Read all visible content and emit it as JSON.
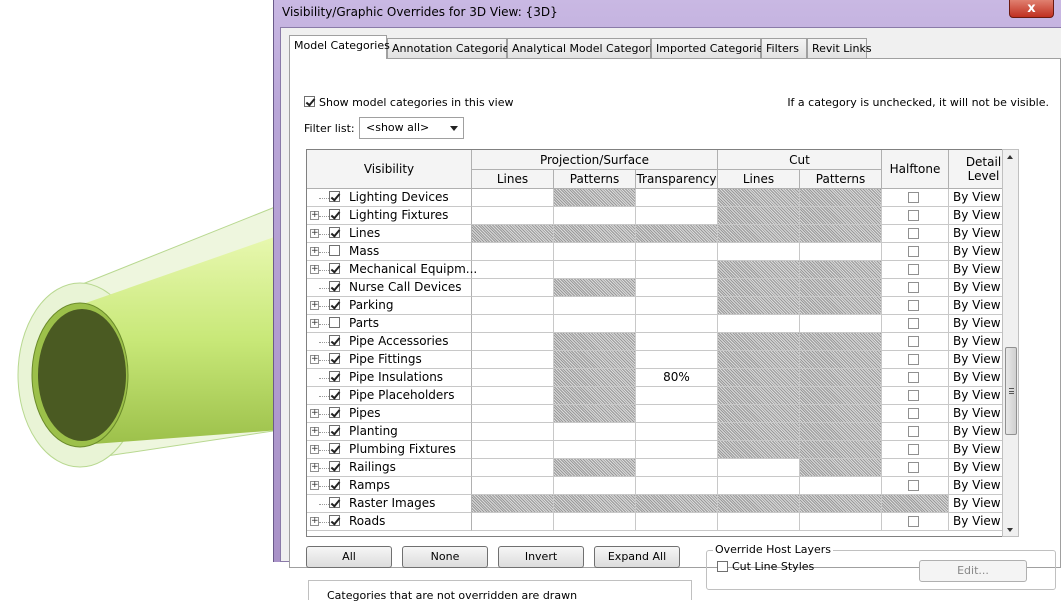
{
  "dialog": {
    "title": "Visibility/Graphic Overrides for 3D View: {3D}",
    "close_glyph": "x"
  },
  "tabs": [
    {
      "label": "Model Categories",
      "active": true
    },
    {
      "label": "Annotation Categories"
    },
    {
      "label": "Analytical Model Categories"
    },
    {
      "label": "Imported Categories"
    },
    {
      "label": "Filters"
    },
    {
      "label": "Revit Links"
    }
  ],
  "show_categories": {
    "label": "Show model categories in this view",
    "checked": true
  },
  "hint_text": "If a category is unchecked, it will not be visible.",
  "filter": {
    "label": "Filter list:",
    "value": "<show all>"
  },
  "table": {
    "headers": {
      "visibility": "Visibility",
      "projection_surface": "Projection/Surface",
      "cut": "Cut",
      "halftone": "Halftone",
      "detail_level": "Detail Level",
      "lines": "Lines",
      "patterns": "Patterns",
      "transparency": "Transparency",
      "cut_lines": "Lines",
      "cut_patterns": "Patterns"
    },
    "rows": [
      {
        "name": "Lighting Devices",
        "expander": false,
        "checked": true,
        "transparency": "",
        "detail": "By View"
      },
      {
        "name": "Lighting Fixtures",
        "expander": true,
        "checked": true,
        "transparency": "",
        "detail": "By View"
      },
      {
        "name": "Lines",
        "expander": true,
        "checked": true,
        "transparency": "",
        "detail": "By View"
      },
      {
        "name": "Mass",
        "expander": true,
        "checked": false,
        "transparency": "",
        "detail": "By View"
      },
      {
        "name": "Mechanical Equipm...",
        "expander": true,
        "checked": true,
        "transparency": "",
        "detail": "By View"
      },
      {
        "name": "Nurse Call Devices",
        "expander": false,
        "checked": true,
        "transparency": "",
        "detail": "By View"
      },
      {
        "name": "Parking",
        "expander": true,
        "checked": true,
        "transparency": "",
        "detail": "By View"
      },
      {
        "name": "Parts",
        "expander": true,
        "checked": false,
        "transparency": "",
        "detail": "By View"
      },
      {
        "name": "Pipe Accessories",
        "expander": false,
        "checked": true,
        "transparency": "",
        "detail": "By View"
      },
      {
        "name": "Pipe Fittings",
        "expander": true,
        "checked": true,
        "transparency": "",
        "detail": "By View"
      },
      {
        "name": "Pipe Insulations",
        "expander": false,
        "checked": true,
        "transparency": "80%",
        "detail": "By View"
      },
      {
        "name": "Pipe Placeholders",
        "expander": false,
        "checked": true,
        "transparency": "",
        "detail": "By View"
      },
      {
        "name": "Pipes",
        "expander": true,
        "checked": true,
        "transparency": "",
        "detail": "By View"
      },
      {
        "name": "Planting",
        "expander": true,
        "checked": true,
        "transparency": "",
        "detail": "By View"
      },
      {
        "name": "Plumbing Fixtures",
        "expander": true,
        "checked": true,
        "transparency": "",
        "detail": "By View"
      },
      {
        "name": "Railings",
        "expander": true,
        "checked": true,
        "transparency": "",
        "detail": "By View"
      },
      {
        "name": "Ramps",
        "expander": true,
        "checked": true,
        "transparency": "",
        "detail": "By View"
      },
      {
        "name": "Raster Images",
        "expander": false,
        "checked": true,
        "transparency": "",
        "detail": "By View"
      },
      {
        "name": "Roads",
        "expander": true,
        "checked": true,
        "transparency": "",
        "detail": "By View"
      }
    ]
  },
  "buttons": {
    "all": "All",
    "none": "None",
    "invert": "Invert",
    "expand_all": "Expand All"
  },
  "override_host_layers": {
    "title": "Override Host Layers",
    "cut_line_styles": "Cut Line Styles",
    "edit": "Edit..."
  },
  "footer_text": "Categories that are not overridden are drawn"
}
